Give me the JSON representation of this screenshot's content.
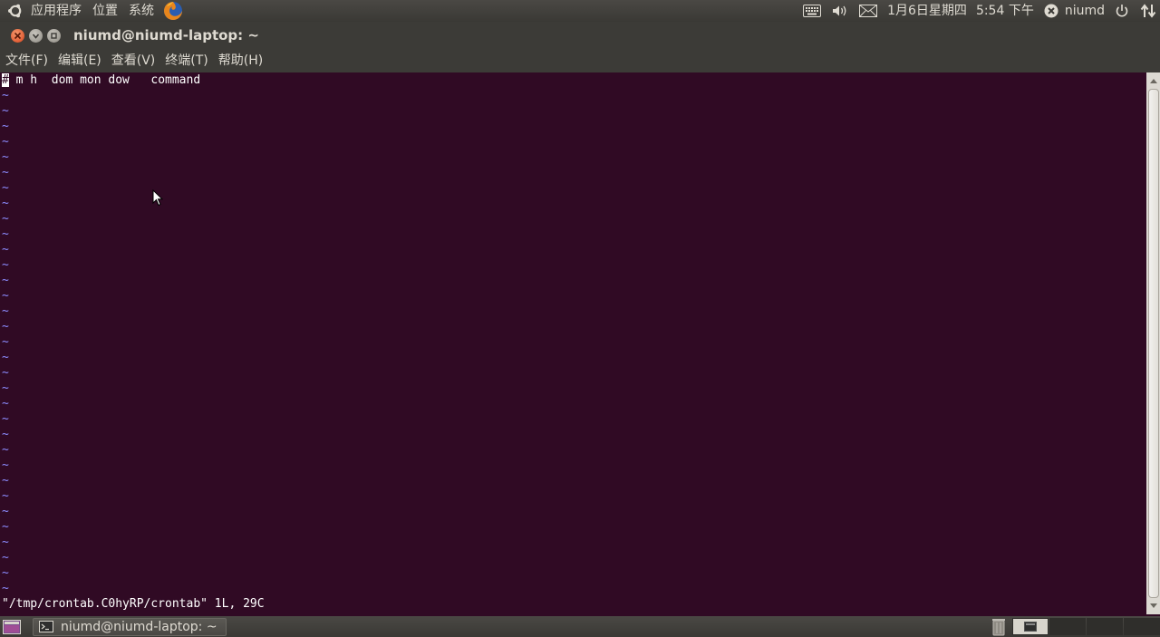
{
  "top_panel": {
    "menus": [
      "应用程序",
      "位置",
      "系统"
    ],
    "date": "1月6日星期四",
    "time": "5:54 下午",
    "user": "niumd",
    "icons": [
      "ubuntu-logo",
      "firefox-icon",
      "keyboard-icon",
      "volume-icon",
      "mail-icon",
      "user-status-icon",
      "power-icon",
      "network-icon"
    ]
  },
  "window": {
    "title": "niumd@niumd-laptop: ~"
  },
  "menubar": {
    "items": [
      "文件(F)",
      "编辑(E)",
      "查看(V)",
      "终端(T)",
      "帮助(H)"
    ]
  },
  "terminal": {
    "cursor_char": "#",
    "first_line_rest": " m h  dom mon dow   command",
    "tilde_char": "~",
    "tilde_count": 33,
    "status_line": "\"/tmp/crontab.C0hyRP/crontab\" 1L, 29C",
    "colors": {
      "background": "#300a24",
      "tilde": "#8c8cff",
      "text": "#ffffff"
    }
  },
  "bottom_panel": {
    "task_title": "niumd@niumd-laptop: ~",
    "workspaces": 4,
    "active_workspace": 1
  }
}
